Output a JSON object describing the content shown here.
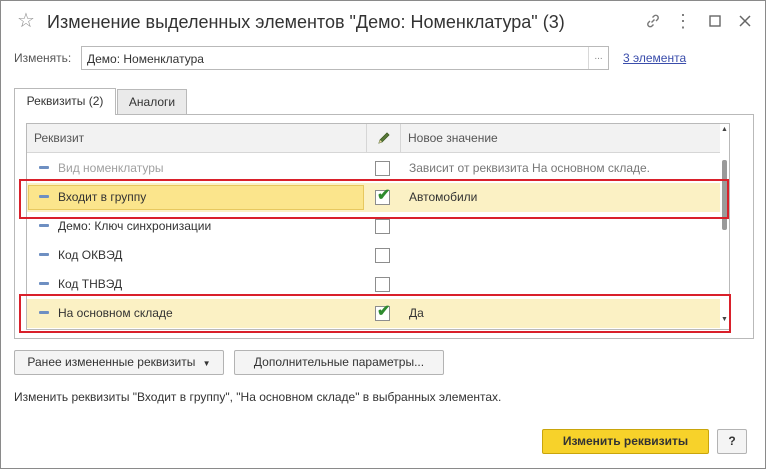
{
  "window": {
    "title": "Изменение выделенных элементов \"Демо: Номенклатура\" (3)",
    "icons": {
      "favorite": "star-icon",
      "link": "link-icon",
      "more": "more-icon",
      "maximize": "maximize-icon",
      "close": "close-icon"
    }
  },
  "change": {
    "label": "Изменять:",
    "value": "Демо: Номенклатура",
    "select_label": "...",
    "elements_link": "3 элемента"
  },
  "tabs": [
    {
      "label": "Реквизиты (2)",
      "active": true
    },
    {
      "label": "Аналоги",
      "active": false
    }
  ],
  "grid": {
    "columns": {
      "attribute": "Реквизит",
      "edit_icon": "pencil-icon",
      "new_value": "Новое значение"
    },
    "rows": [
      {
        "name": "Вид номенклатуры",
        "checked": false,
        "value": "Зависит от реквизита На основном складе.",
        "disabled": true,
        "selected": false
      },
      {
        "name": "Входит в группу",
        "checked": true,
        "value": "Автомобили",
        "disabled": false,
        "selected": true
      },
      {
        "name": "Демо: Ключ синхронизации",
        "checked": false,
        "value": "",
        "disabled": false,
        "selected": false
      },
      {
        "name": "Код ОКВЭД",
        "checked": false,
        "value": "",
        "disabled": false,
        "selected": false
      },
      {
        "name": "Код ТНВЭД",
        "checked": false,
        "value": "",
        "disabled": false,
        "selected": false
      },
      {
        "name": "На основном складе",
        "checked": true,
        "value": "Да",
        "disabled": false,
        "selected": true
      }
    ]
  },
  "buttons": {
    "previous": "Ранее измененные реквизиты",
    "previous_icon": "dropdown-arrow-icon",
    "extra": "Дополнительные параметры...",
    "apply": "Изменить реквизиты",
    "help": "?"
  },
  "info_text": "Изменить реквизиты \"Входит в группу\", \"На основном складе\" в выбранных элементах.",
  "colors": {
    "highlight": "#d9202b",
    "selected_row": "#fbf1c4",
    "primary_button": "#f7d22a",
    "link": "#3a4dab"
  }
}
